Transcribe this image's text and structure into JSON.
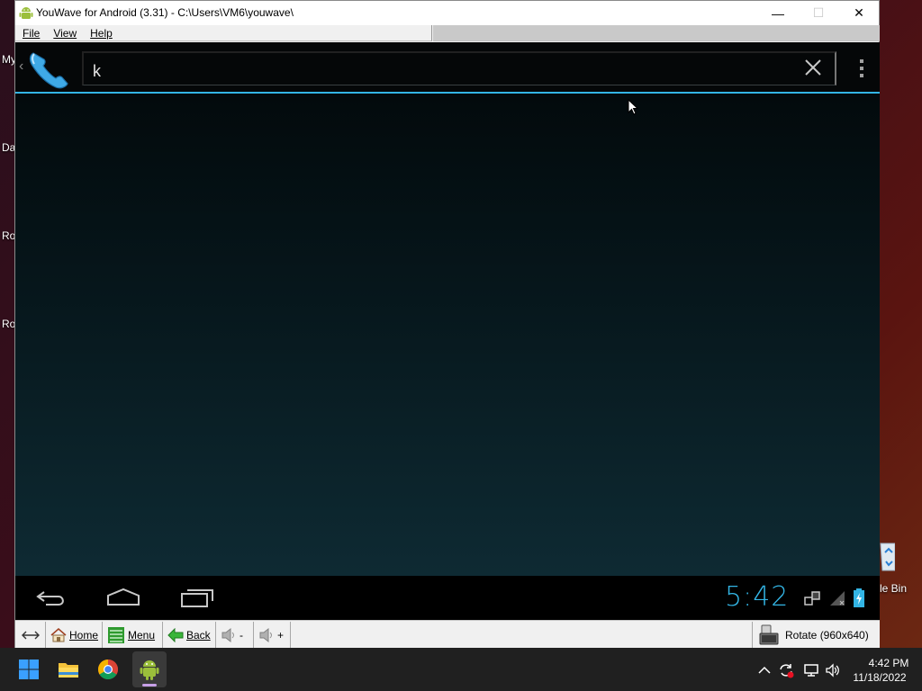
{
  "desktop": {
    "labels": [
      "My",
      "Da",
      "Ro",
      "Ro"
    ],
    "recycle_label": "le Bin"
  },
  "window": {
    "title": "YouWave for Android (3.31) - C:\\Users\\VM6\\youwave\\",
    "controls": {
      "minimize": "—",
      "maximize": "☐",
      "close": "✕"
    },
    "menu": [
      "File",
      "View",
      "Help"
    ]
  },
  "android": {
    "search": {
      "value": "k",
      "placeholder": ""
    },
    "status": {
      "clock": "5:42",
      "accent_color": "#33b5e5"
    },
    "icons": {
      "app": "phone-icon",
      "clear": "close-icon",
      "overflow": "overflow-menu-icon",
      "nav": [
        "back-icon",
        "home-icon",
        "recent-apps-icon"
      ]
    }
  },
  "toolbar": {
    "home_label": "Home",
    "menu_label": "Menu",
    "back_label": "Back",
    "vol_down_label": "-",
    "vol_up_label": "+",
    "rotate_label": "Rotate (960x640)"
  },
  "taskbar": {
    "time": "4:42 PM",
    "date": "11/18/2022"
  }
}
